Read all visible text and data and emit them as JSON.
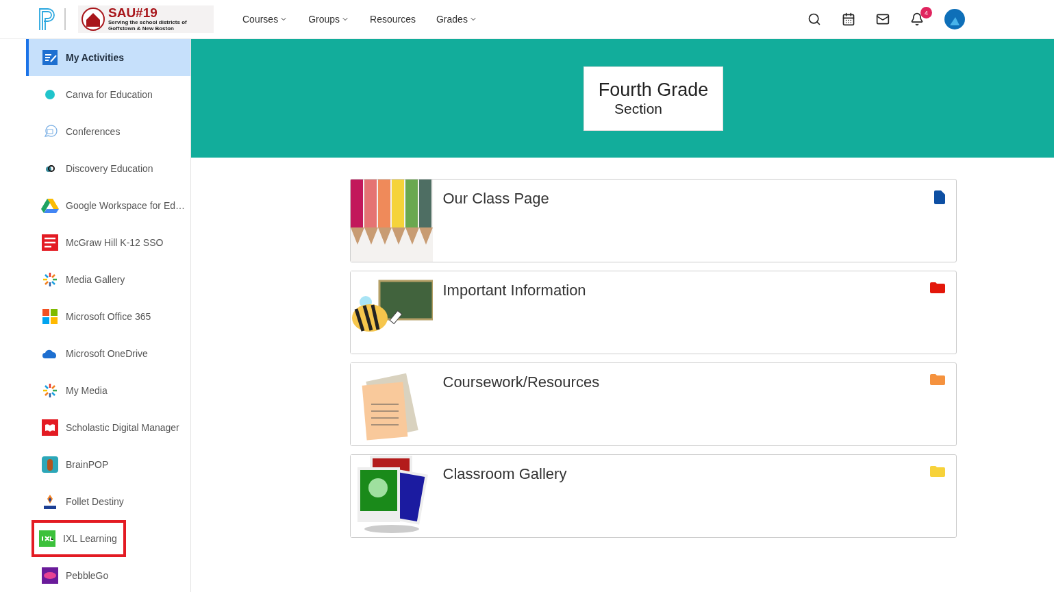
{
  "header": {
    "district_logo": {
      "title": "SAU#19",
      "subtitle": "Serving the school districts of Goffstown & New Boston"
    },
    "nav": [
      {
        "label": "Courses",
        "dropdown": true
      },
      {
        "label": "Groups",
        "dropdown": true
      },
      {
        "label": "Resources",
        "dropdown": false
      },
      {
        "label": "Grades",
        "dropdown": true
      }
    ],
    "notifications_badge": "4"
  },
  "sidebar": {
    "items": [
      {
        "label": "My Activities",
        "selected": true,
        "highlighted": false
      },
      {
        "label": "Canva for Education",
        "selected": false,
        "highlighted": false
      },
      {
        "label": "Conferences",
        "selected": false,
        "highlighted": false
      },
      {
        "label": "Discovery Education",
        "selected": false,
        "highlighted": false
      },
      {
        "label": "Google Workspace for Ed…",
        "selected": false,
        "highlighted": false
      },
      {
        "label": "McGraw Hill K-12 SSO",
        "selected": false,
        "highlighted": false
      },
      {
        "label": "Media Gallery",
        "selected": false,
        "highlighted": false
      },
      {
        "label": "Microsoft Office 365",
        "selected": false,
        "highlighted": false
      },
      {
        "label": "Microsoft OneDrive",
        "selected": false,
        "highlighted": false
      },
      {
        "label": "My Media",
        "selected": false,
        "highlighted": false
      },
      {
        "label": "Scholastic Digital Manager",
        "selected": false,
        "highlighted": false
      },
      {
        "label": "BrainPOP",
        "selected": false,
        "highlighted": false
      },
      {
        "label": "Follet Destiny",
        "selected": false,
        "highlighted": false
      },
      {
        "label": "IXL Learning",
        "selected": false,
        "highlighted": true
      },
      {
        "label": "PebbleGo",
        "selected": false,
        "highlighted": false
      }
    ]
  },
  "banner": {
    "title": "Fourth Grade",
    "subtitle": "Section"
  },
  "items": [
    {
      "title": "Our Class Page",
      "kind": "page",
      "color": "#0d4fa3"
    },
    {
      "title": "Important Information",
      "kind": "folder",
      "color": "#e3170a"
    },
    {
      "title": "Coursework/Resources",
      "kind": "folder",
      "color": "#f5923e"
    },
    {
      "title": "Classroom Gallery",
      "kind": "folder",
      "color": "#f7d23a"
    }
  ]
}
